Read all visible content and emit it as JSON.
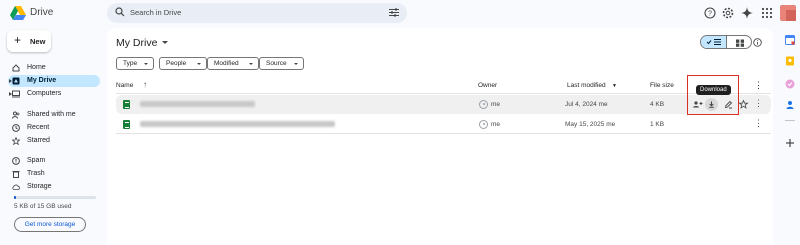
{
  "app": {
    "title": "Drive"
  },
  "header": {
    "search_placeholder": "Search in Drive",
    "icons": [
      "help-icon",
      "settings-icon",
      "gemini-icon",
      "apps-grid-icon"
    ]
  },
  "sidebar": {
    "new_label": "New",
    "items": [
      {
        "label": "Home",
        "icon": "home-icon"
      },
      {
        "label": "My Drive",
        "icon": "my-drive-icon",
        "active": true
      },
      {
        "label": "Computers",
        "icon": "computer-icon"
      },
      {
        "label": "Shared with me",
        "icon": "shared-icon"
      },
      {
        "label": "Recent",
        "icon": "clock-icon"
      },
      {
        "label": "Starred",
        "icon": "star-icon"
      },
      {
        "label": "Spam",
        "icon": "spam-icon"
      },
      {
        "label": "Trash",
        "icon": "trash-icon"
      },
      {
        "label": "Storage",
        "icon": "cloud-icon"
      }
    ],
    "storage_text": "5 KB of 15 GB used",
    "storage_fraction": 0.0003,
    "get_storage_label": "Get more storage"
  },
  "main": {
    "title": "My Drive",
    "filters": [
      "Type",
      "People",
      "Modified",
      "Source"
    ],
    "columns": {
      "name": "Name",
      "owner": "Owner",
      "modified": "Last modified",
      "size": "File size"
    },
    "rows": [
      {
        "owner": "me",
        "modified": "Jul 4, 2024 me",
        "size": "4 KB"
      },
      {
        "owner": "me",
        "modified": "May 15, 2025 me",
        "size": "1 KB"
      }
    ],
    "tooltip": "Download"
  },
  "colors": {
    "accent": "#0b57d0",
    "active_nav": "#c2e7ff",
    "sheets_green": "#188038",
    "highlight": "#d93025"
  }
}
